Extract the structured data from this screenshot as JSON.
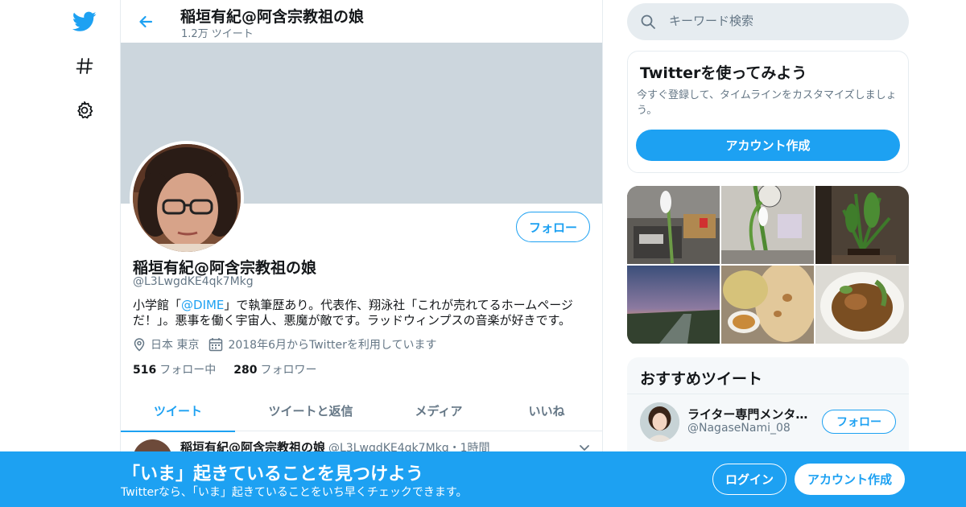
{
  "nav": {
    "icons": [
      "twitter-logo-icon",
      "hashtag-icon",
      "gear-icon"
    ]
  },
  "header": {
    "title": "稲垣有紀@阿含宗教祖の娘",
    "tweet_count": "1.2万 ツイート"
  },
  "profile": {
    "follow_label": "フォロー",
    "name": "稲垣有紀@阿含宗教祖の娘",
    "handle": "@L3LwgdKE4qk7Mkg",
    "bio_part1": "小学館「",
    "bio_link": "@DIME",
    "bio_part2": "」で執筆歴あり。代表作、翔泳社「これが売れてるホームページだ！」。悪事を働く宇宙人、悪魔が敵です。ラッドウィンプスの音楽が好きです。",
    "location": "日本 東京",
    "joined": "2018年6月からTwitterを利用しています",
    "following_count": "516",
    "following_label": "フォロー中",
    "followers_count": "280",
    "followers_label": "フォロワー"
  },
  "tabs": [
    {
      "label": "ツイート",
      "active": true
    },
    {
      "label": "ツイートと返信",
      "active": false
    },
    {
      "label": "メディア",
      "active": false
    },
    {
      "label": "いいね",
      "active": false
    }
  ],
  "tweet": {
    "name": "稲垣有紀@阿含宗教祖の娘",
    "meta": "@L3LwgdKE4qk7Mkg・1時間"
  },
  "search": {
    "placeholder": "キーワード検索"
  },
  "signup_card": {
    "title": "Twitterを使ってみよう",
    "description": "今すぐ登録して、タイムラインをカスタマイズしましょう。",
    "button": "アカウント作成"
  },
  "gallery": {
    "photos": [
      "room-with-plant",
      "plant-and-clock",
      "ikebana",
      "sunset-riverbank",
      "naan-curry-plate",
      "soup-bowl"
    ]
  },
  "recommended": {
    "title": "おすすめツイート",
    "user_name": "ライター専門メンタ…",
    "user_handle": "@NagaseNami_08",
    "follow_label": "フォロー"
  },
  "bottom_banner": {
    "title": "「いま」起きていることを見つけよう",
    "subtitle": "Twitterなら、「いま」起きていることをいち早くチェックできます。",
    "login": "ログイン",
    "signup": "アカウント作成"
  },
  "colors": {
    "brand": "#1da1f2",
    "banner_gray": "#ccd6dd",
    "text_secondary": "#657786"
  }
}
